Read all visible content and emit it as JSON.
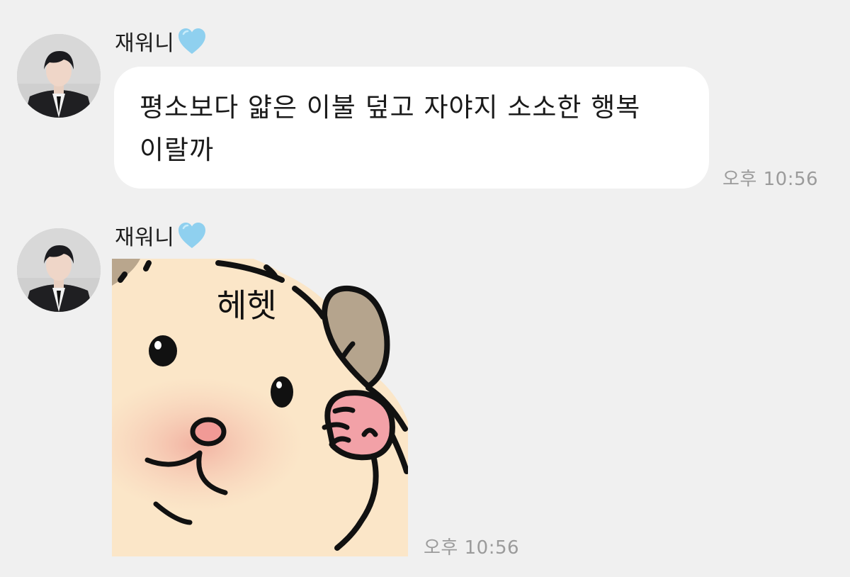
{
  "messages": [
    {
      "sender": "재워니",
      "text": "평소보다 얇은 이불 덮고 자야지 소소한 행복\n이랄까",
      "time": "오후 10:56"
    },
    {
      "sender": "재워니",
      "sticker": {
        "icon": "hamster-sticker",
        "caption": "헤헷"
      },
      "time": "오후 10:56"
    }
  ],
  "colors": {
    "background": "#f0f0f0",
    "bubble": "#ffffff",
    "heart": "#8fd0ef",
    "timestamp": "#9b9b9b"
  }
}
